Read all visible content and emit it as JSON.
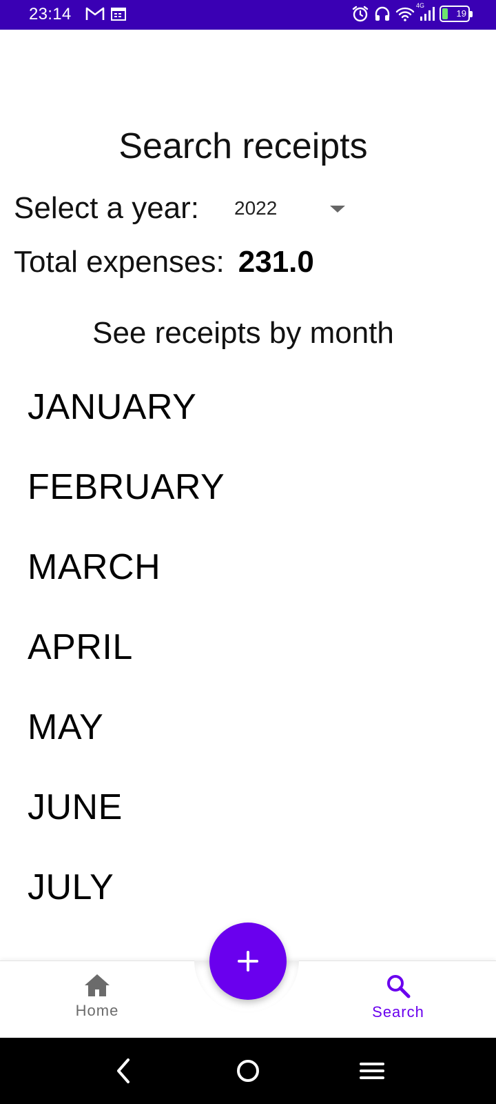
{
  "status_bar": {
    "time": "23:14",
    "network": "4G",
    "battery": "19",
    "icons": [
      "gmail-icon",
      "calendar-icon",
      "alarm-icon",
      "headphones-icon",
      "wifi-icon",
      "signal-icon",
      "battery-charging-icon"
    ],
    "background_color": "#3a00b4"
  },
  "main": {
    "title": "Search receipts",
    "year_label": "Select a year:",
    "year_selected": "2022",
    "expenses_label": "Total expenses:",
    "expenses_value": "231.0",
    "section_title": "See receipts by month",
    "months": [
      "JANUARY",
      "FEBRUARY",
      "MARCH",
      "APRIL",
      "MAY",
      "JUNE",
      "JULY"
    ]
  },
  "fab": {
    "icon": "plus-icon",
    "color": "#6a00ee"
  },
  "bottom_nav": {
    "items": [
      {
        "label": "Home",
        "icon": "home-icon",
        "active": false
      },
      {
        "label": "Search",
        "icon": "search-icon",
        "active": true
      }
    ],
    "active_color": "#6a00ee",
    "inactive_color": "#6b6b6b"
  },
  "system_nav": {
    "icons": [
      "back-icon",
      "home-circle-icon",
      "menu-icon"
    ]
  }
}
